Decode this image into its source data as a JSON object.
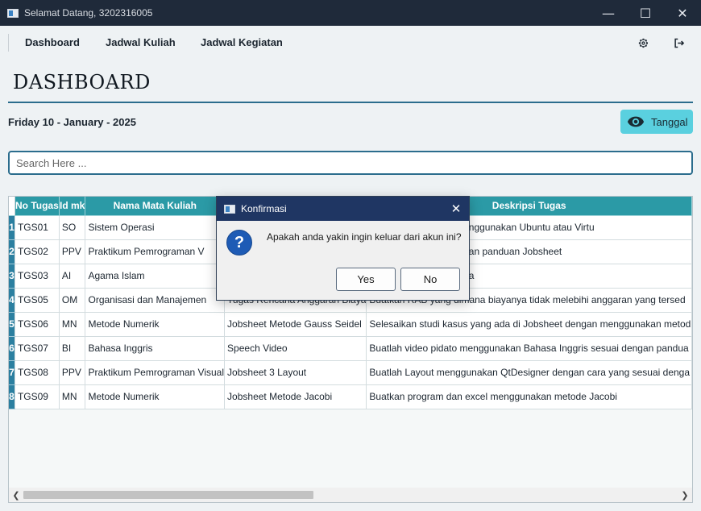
{
  "window": {
    "title": "Selamat Datang, 3202316005",
    "min": "—",
    "max": "☐",
    "close": "✕"
  },
  "nav": {
    "items": [
      "Dashboard",
      "Jadwal Kuliah",
      "Jadwal Kegiatan"
    ],
    "settings_icon": "gear-icon",
    "logout_icon": "logout-icon"
  },
  "page": {
    "title": "DASHBOARD",
    "date": "Friday 10 - January - 2025",
    "tanggal_label": "Tanggal",
    "search_placeholder": "Search Here ..."
  },
  "table": {
    "columns": [
      "No Tugas",
      "Id mk",
      "Nama Mata Kuliah",
      "",
      "Deskripsi Tugas"
    ],
    "rows": [
      {
        "num": "1",
        "no": "TGS01",
        "id": "SO",
        "nama": "Sistem Operasi",
        "tugas": "",
        "desk": "n Linus dan MacOs menggunakan Ubuntu atau Virtu"
      },
      {
        "num": "2",
        "no": "TGS02",
        "id": "PPV",
        "nama": "Praktikum Pemrograman V",
        "tugas": "",
        "desk": "di VsCode sesuai dengan panduan Jobsheet"
      },
      {
        "num": "3",
        "no": "TGS03",
        "id": "AI",
        "nama": "Agama Islam",
        "tugas": "",
        "desk": "ntaan maaf ke orang tua"
      },
      {
        "num": "4",
        "no": "TGS05",
        "id": "OM",
        "nama": "Organisasi dan Manajemen",
        "tugas": "Tugas Rencana Anggaran Biaya",
        "desk": "Buatkan RAB yang dimana biayanya tidak melebihi anggaran yang tersed"
      },
      {
        "num": "5",
        "no": "TGS06",
        "id": "MN",
        "nama": "Metode Numerik",
        "tugas": "Jobsheet Metode Gauss Seidel",
        "desk": "Selesaikan studi kasus yang ada di Jobsheet dengan menggunakan metod"
      },
      {
        "num": "6",
        "no": "TGS07",
        "id": "BI",
        "nama": "Bahasa Inggris",
        "tugas": "Speech Video",
        "desk": "Buatlah video pidato menggunakan Bahasa Inggris sesuai dengan pandua"
      },
      {
        "num": "7",
        "no": "TGS08",
        "id": "PPV",
        "nama": "Praktikum Pemrograman Visual",
        "tugas": "Jobsheet 3 Layout",
        "desk": "Buatlah Layout menggunakan QtDesigner dengan cara yang sesuai denga"
      },
      {
        "num": "8",
        "no": "TGS09",
        "id": "MN",
        "nama": "Metode Numerik",
        "tugas": "Jobsheet Metode Jacobi",
        "desk": "Buatkan program dan excel menggunakan metode Jacobi"
      }
    ]
  },
  "dialog": {
    "title": "Konfirmasi",
    "message": "Apakah anda yakin ingin keluar dari akun ini?",
    "yes": "Yes",
    "no": "No",
    "icon": "question-icon"
  },
  "colors": {
    "accent": "#2b9aa6",
    "rownum": "#2b7fa0",
    "tanggal": "#5ad0df",
    "dialog_title": "#1f3663",
    "titlebar": "#1f2a3a"
  }
}
